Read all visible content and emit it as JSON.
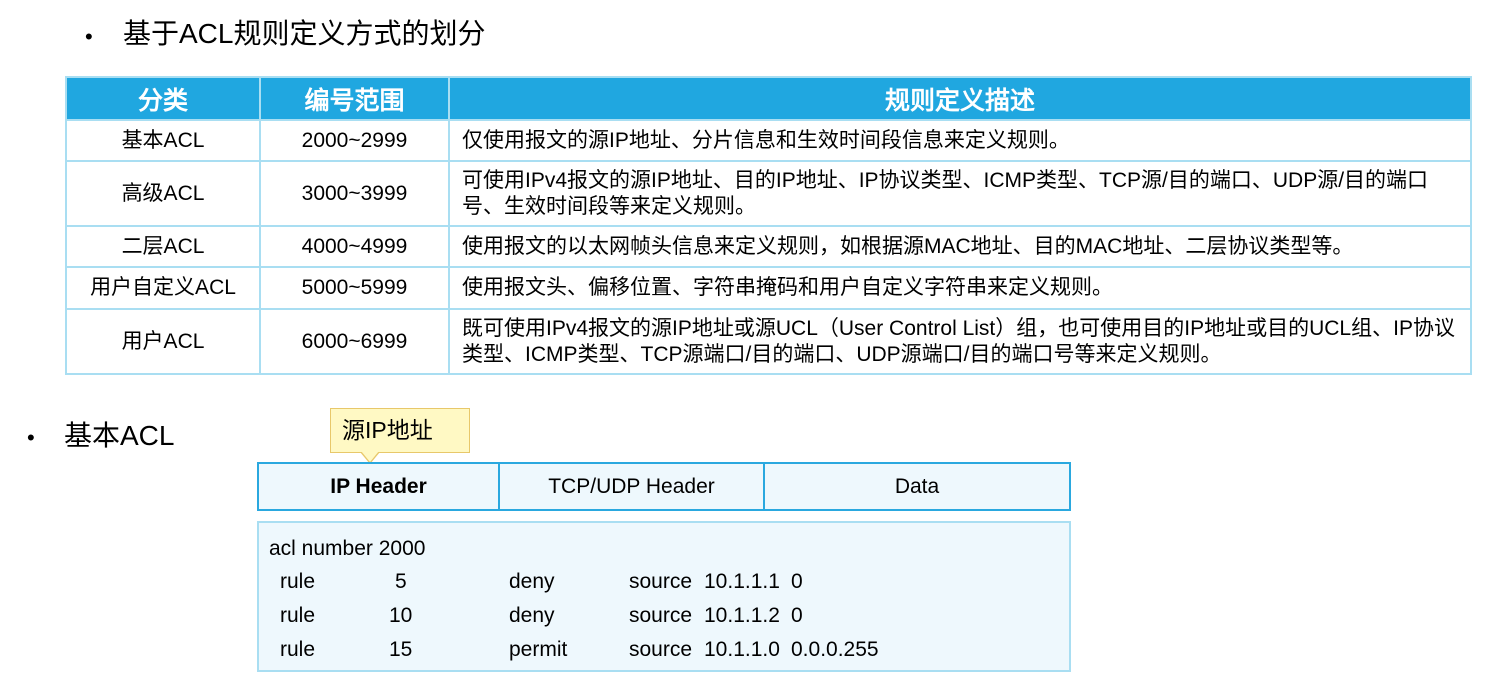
{
  "section1": {
    "bullet": "•",
    "title": "基于ACL规则定义方式的划分"
  },
  "table": {
    "headers": [
      "分类",
      "编号范围",
      "规则定义描述"
    ],
    "rows": [
      {
        "category": "基本ACL",
        "range": "2000~2999",
        "description": "仅使用报文的源IP地址、分片信息和生效时间段信息来定义规则。"
      },
      {
        "category": "高级ACL",
        "range": "3000~3999",
        "description": "可使用IPv4报文的源IP地址、目的IP地址、IP协议类型、ICMP类型、TCP源/目的端口、UDP源/目的端口号、生效时间段等来定义规则。"
      },
      {
        "category": "二层ACL",
        "range": "4000~4999",
        "description": "使用报文的以太网帧头信息来定义规则，如根据源MAC地址、目的MAC地址、二层协议类型等。"
      },
      {
        "category": "用户自定义ACL",
        "range": "5000~5999",
        "description": "使用报文头、偏移位置、字符串掩码和用户自定义字符串来定义规则。"
      },
      {
        "category": "用户ACL",
        "range": "6000~6999",
        "description": "既可使用IPv4报文的源IP地址或源UCL（User Control List）组，也可使用目的IP地址或目的UCL组、IP协议类型、ICMP类型、TCP源端口/目的端口、UDP源端口/目的端口号等来定义规则。"
      }
    ],
    "colors": {
      "header_bg": "#20a7e0",
      "border": "#a9def2"
    }
  },
  "section2": {
    "bullet": "•",
    "title": "基本ACL"
  },
  "callout": {
    "text": "源IP地址"
  },
  "packet": {
    "segments": [
      "IP Header",
      "TCP/UDP Header",
      "Data"
    ]
  },
  "acl_config": {
    "header": "acl number 2000",
    "rules": [
      {
        "keyword": "rule",
        "id": "5",
        "action": "deny",
        "source_kw": "source",
        "address": "10.1.1.1",
        "wildcard": "0"
      },
      {
        "keyword": "rule",
        "id": "10",
        "action": "deny",
        "source_kw": "source",
        "address": "10.1.1.2",
        "wildcard": "0"
      },
      {
        "keyword": "rule",
        "id": "15",
        "action": "permit",
        "source_kw": "source",
        "address": "10.1.1.0",
        "wildcard": "0.0.0.255"
      }
    ]
  }
}
